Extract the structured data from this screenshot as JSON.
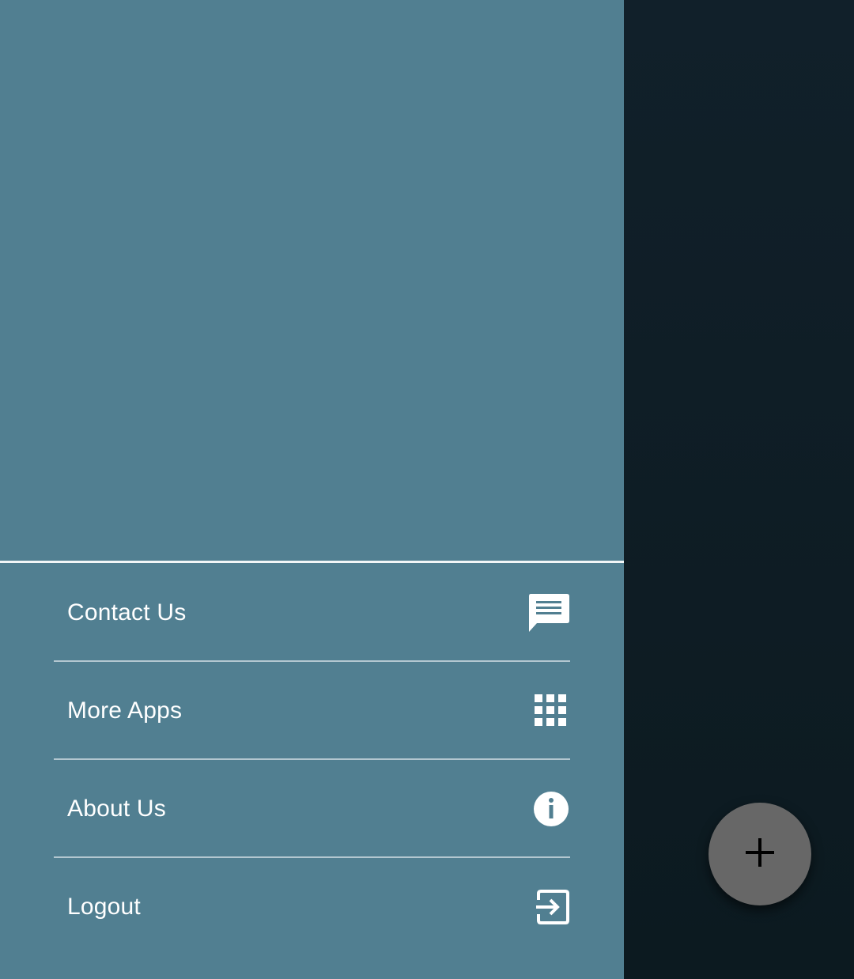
{
  "drawer": {
    "header": {
      "background": "#517f91"
    },
    "items": [
      {
        "label": "Contact Us",
        "icon": "chat-icon"
      },
      {
        "label": "More Apps",
        "icon": "apps-grid-icon"
      },
      {
        "label": "About Us",
        "icon": "info-icon"
      },
      {
        "label": "Logout",
        "icon": "logout-icon"
      }
    ]
  },
  "fab": {
    "icon": "plus-icon",
    "color": "#676767"
  },
  "colors": {
    "drawer": "#517f91",
    "scrim": "#0f1f25",
    "text": "#ffffff"
  }
}
